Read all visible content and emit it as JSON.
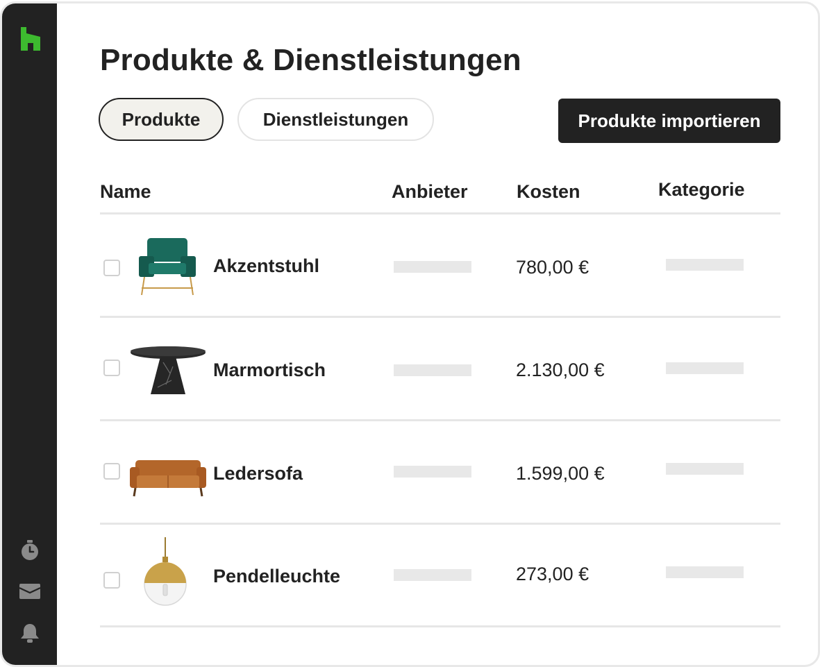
{
  "page": {
    "title": "Produkte & Dienstleistungen"
  },
  "tabs": [
    {
      "label": "Produkte",
      "active": true
    },
    {
      "label": "Dienstleistungen",
      "active": false
    }
  ],
  "actions": {
    "import_label": "Produkte importieren"
  },
  "sidebar": {
    "logo": "houzz-logo",
    "icons": [
      "stopwatch-icon",
      "inbox-icon",
      "bell-icon"
    ],
    "logo_color": "#3dba2f"
  },
  "table": {
    "columns": [
      "Name",
      "Anbieter",
      "Kosten",
      "Kategorie"
    ],
    "rows": [
      {
        "name": "Akzentstuhl",
        "price": "780,00 €",
        "image": "accent-chair-image"
      },
      {
        "name": "Marmortisch",
        "price": "2.130,00 €",
        "image": "marble-table-image"
      },
      {
        "name": "Ledersofa",
        "price": "1.599,00 €",
        "image": "leather-sofa-image"
      },
      {
        "name": "Pendelleuchte",
        "price": "273,00 €",
        "image": "pendant-light-image"
      }
    ]
  },
  "colors": {
    "dark": "#222222",
    "accent": "#3dba2f",
    "placeholder": "#e8e8e8",
    "tab_active_bg": "#f2f1ec"
  }
}
